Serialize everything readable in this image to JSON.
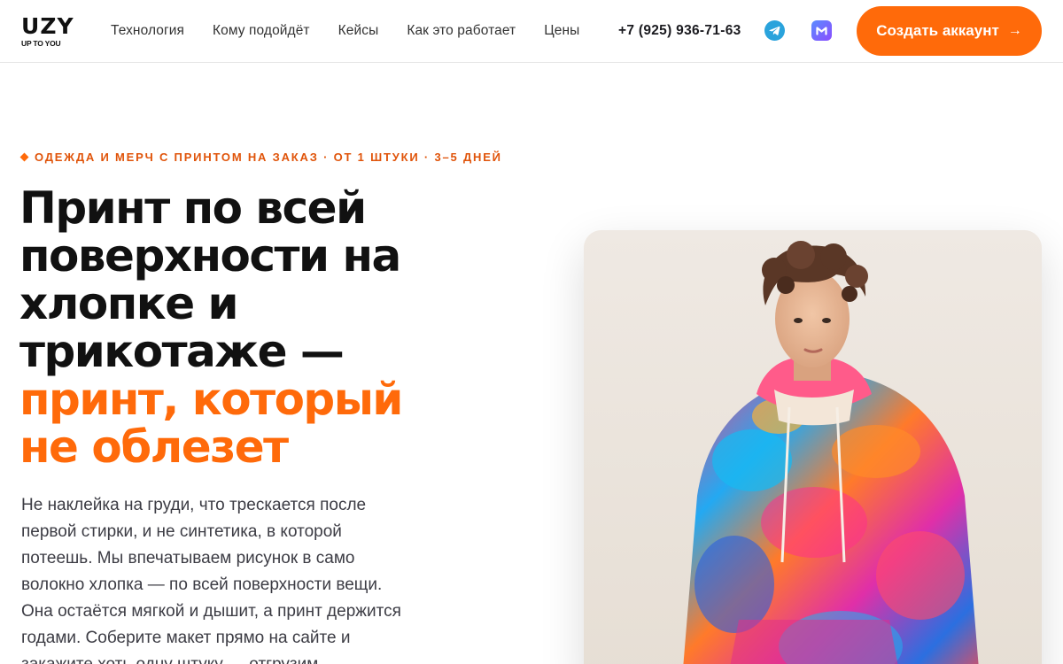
{
  "header": {
    "logo_mark": [
      "U",
      "Z",
      "Y"
    ],
    "logo_sub": "UP TO YOU",
    "nav": [
      "Технология",
      "Кому подойдёт",
      "Кейсы",
      "Как это работает",
      "Цены"
    ],
    "phone": "+7 (925) 936-71-63",
    "social": [
      {
        "icon": "telegram-icon"
      },
      {
        "icon": "max-messenger-icon"
      }
    ],
    "cta_label": "Создать аккаунт",
    "cta_arrow": "→"
  },
  "hero": {
    "eyebrow": "Одежда и мерч с принтом на заказ · от 1 штуки · 3–5 дней",
    "headline_lines": [
      "Принт по всей",
      "поверхности на",
      "хлопке и",
      "трикотаже —"
    ],
    "headline_accent_lines": [
      "принт, который",
      "не облезет"
    ],
    "lead": "Не наклейка на груди, что трескается после первой стирки, и не синтетика, в которой потеешь. Мы впечатываем рисунок в само волокно хлопка — по всей поверхности вещи. Она остаётся мягкой и дышит, а принт держится годами. Соберите макет прямо на сайте и закажите хоть одну штуку — отгрузим"
  },
  "image": {
    "subject": "model-in-tie-dye-hoodie"
  },
  "colors": {
    "accent": "#ff6a0a",
    "eyebrow": "#e0540a",
    "text": "#111111",
    "telegram": "#2aa3dc"
  }
}
